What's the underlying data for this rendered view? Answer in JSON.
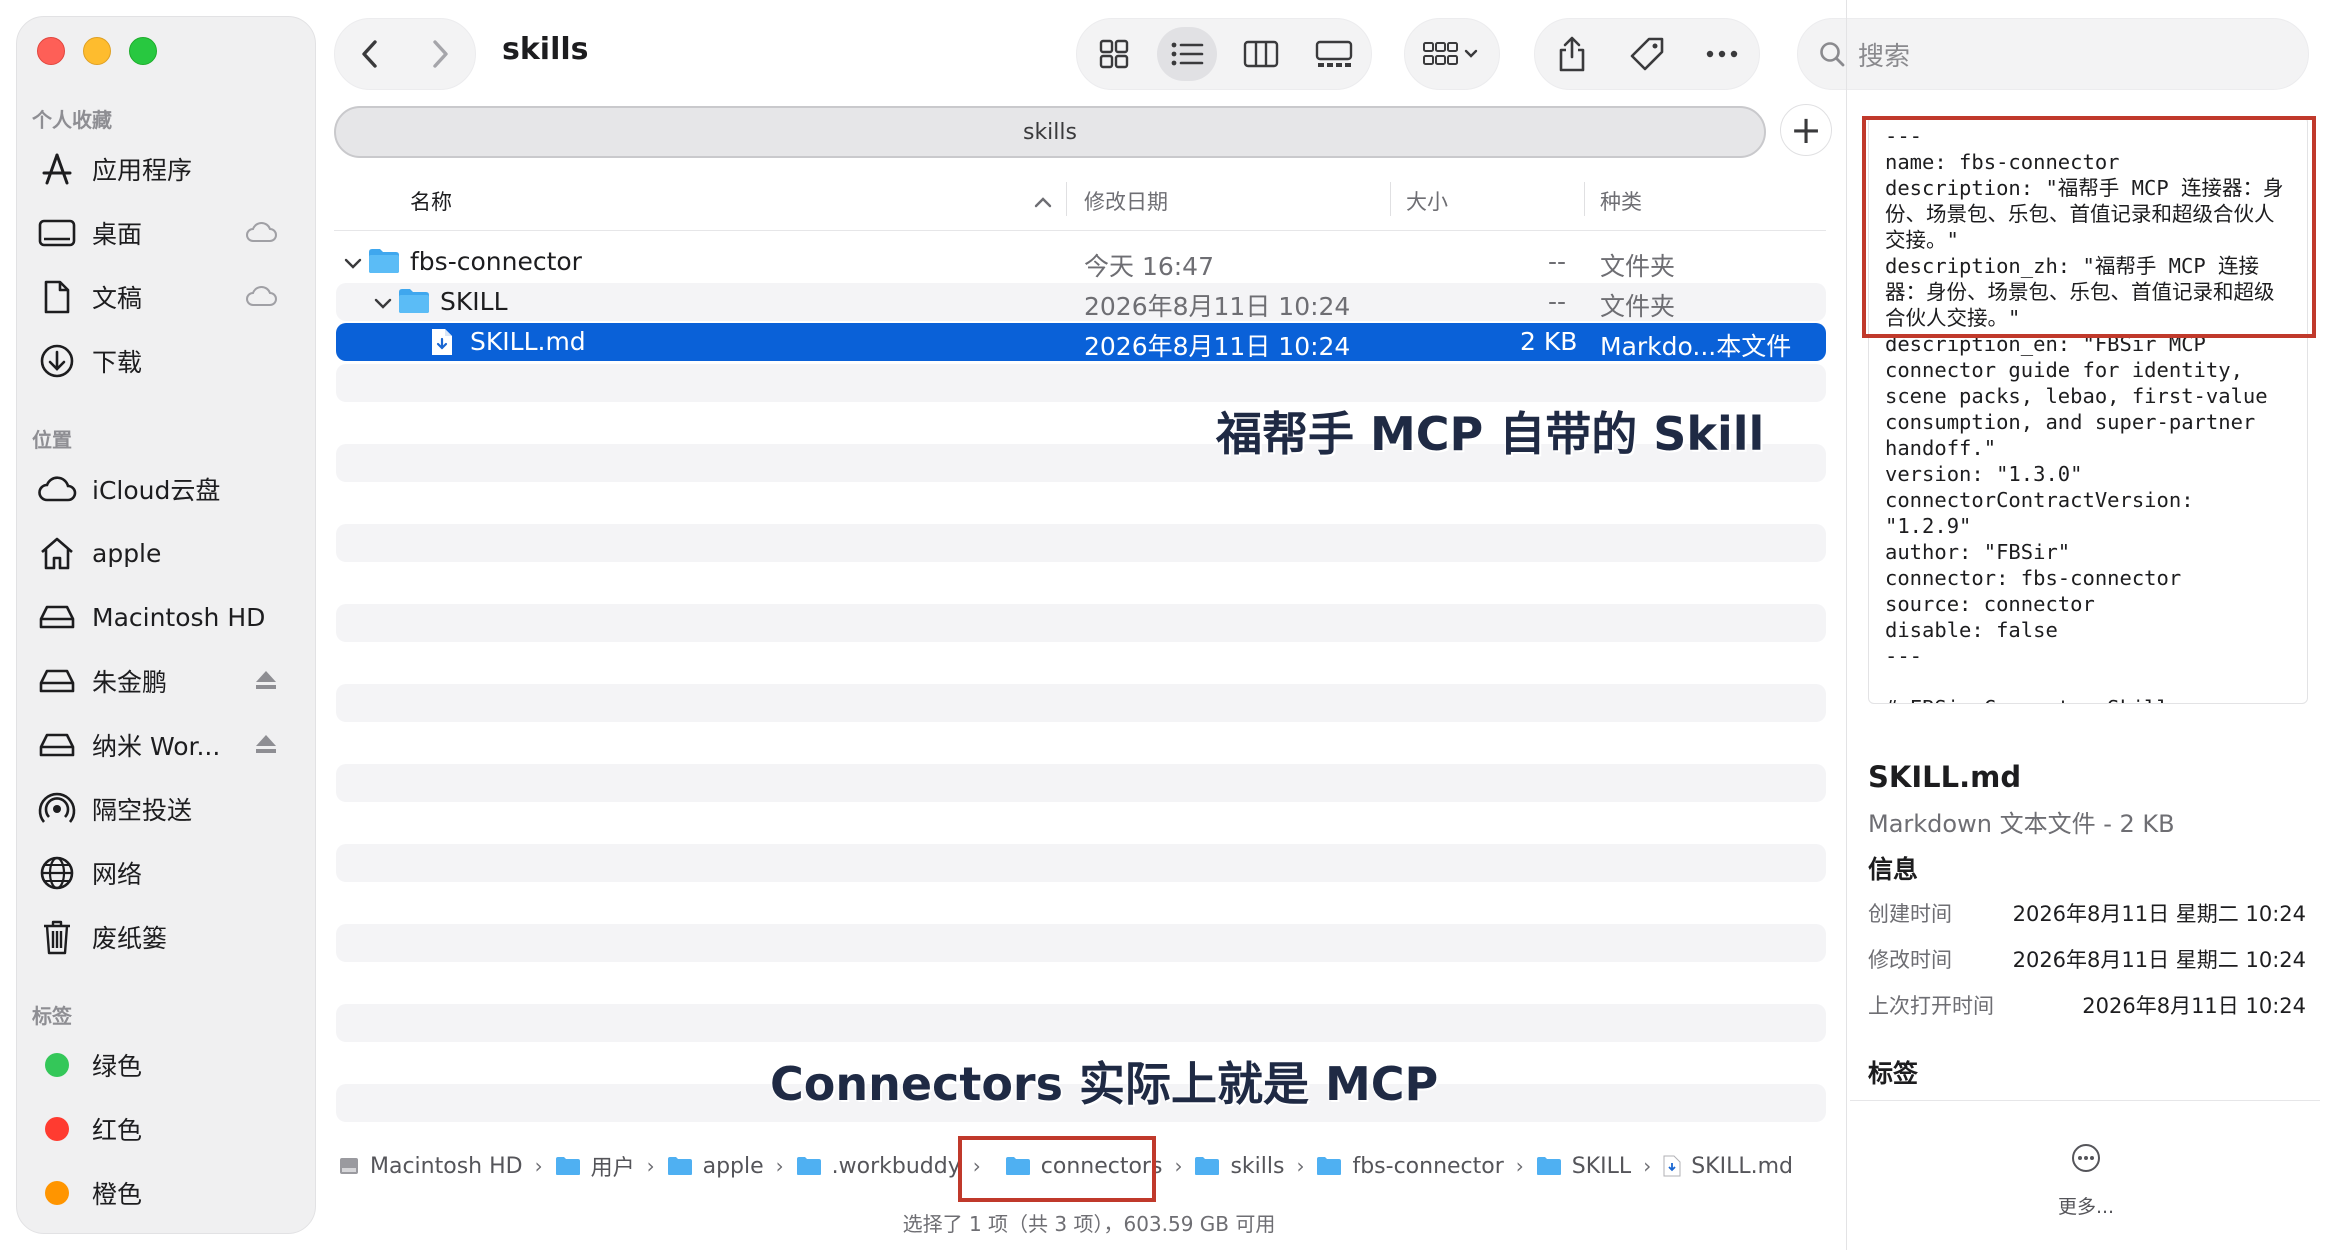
{
  "window": {
    "title": "skills"
  },
  "sidebar": {
    "sections": {
      "favorites": "个人收藏",
      "locations": "位置",
      "tags": "标签"
    },
    "favorites": [
      {
        "label": "应用程序",
        "icon": "applications-icon"
      },
      {
        "label": "桌面",
        "icon": "desktop-icon",
        "trail": "icloud-icon"
      },
      {
        "label": "文稿",
        "icon": "document-icon",
        "trail": "icloud-icon"
      },
      {
        "label": "下载",
        "icon": "download-icon"
      }
    ],
    "locations": [
      {
        "label": "iCloud云盘",
        "icon": "icloud-icon"
      },
      {
        "label": "apple",
        "icon": "home-icon"
      },
      {
        "label": "Macintosh HD",
        "icon": "disk-icon"
      },
      {
        "label": "朱金鹏",
        "icon": "disk-icon",
        "trail": "eject-icon"
      },
      {
        "label": "纳米 Wor...",
        "icon": "disk-icon",
        "trail": "eject-icon"
      },
      {
        "label": "隔空投送",
        "icon": "airdrop-icon"
      },
      {
        "label": "网络",
        "icon": "network-icon"
      },
      {
        "label": "废纸篓",
        "icon": "trash-icon"
      }
    ],
    "tags": [
      {
        "label": "绿色",
        "color": "#34c759"
      },
      {
        "label": "红色",
        "color": "#ff3b30"
      },
      {
        "label": "橙色",
        "color": "#ff9500"
      }
    ]
  },
  "toolbar": {
    "search_placeholder": "搜索"
  },
  "tabbar": {
    "label": "skills"
  },
  "columns": {
    "name": "名称",
    "modified": "修改日期",
    "size": "大小",
    "kind": "种类"
  },
  "files": [
    {
      "name": "fbs-connector",
      "modified": "今天 16:47",
      "size": "--",
      "kind": "文件夹"
    },
    {
      "name": "SKILL",
      "modified": "2026年8月11日 10:24",
      "size": "--",
      "kind": "文件夹"
    },
    {
      "name": "SKILL.md",
      "modified": "2026年8月11日 10:24",
      "size": "2 KB",
      "kind": "Markdo...本文件"
    }
  ],
  "overlays": {
    "top": "福帮手 MCP 自带的 Skill",
    "bottom": "Connectors 实际上就是 MCP"
  },
  "breadcrumb": [
    "Macintosh HD",
    "用户",
    "apple",
    ".workbuddy",
    "connectors",
    "skills",
    "fbs-connector",
    "SKILL",
    "SKILL.md"
  ],
  "status": "选择了 1 项（共 3 项），603.59 GB 可用",
  "preview": {
    "content": "---\nname: fbs-connector\ndescription: \"福帮手 MCP 连接器：身份、场景包、乐包、首值记录和超级合伙人交接。\"\ndescription_zh: \"福帮手 MCP 连接器：身份、场景包、乐包、首值记录和超级合伙人交接。\"\ndescription_en: \"FBSir MCP connector guide for identity, scene packs, lebao, first-value consumption, and super-partner handoff.\"\nversion: \"1.3.0\"\nconnectorContractVersion: \"1.2.9\"\nauthor: \"FBSir\"\nconnector: fbs-connector\nsource: connector\ndisable: false\n---\n\n# FBSir Connector Skill",
    "name": "SKILL.md",
    "kind": "Markdown 文本文件 - 2 KB",
    "info_title": "信息",
    "info": [
      {
        "key": "创建时间",
        "value": "2026年8月11日 星期二 10:24"
      },
      {
        "key": "修改时间",
        "value": "2026年8月11日 星期二 10:24"
      },
      {
        "key": "上次打开时间",
        "value": "2026年8月11日 10:24"
      }
    ],
    "tags_title": "标签",
    "more": "更多..."
  }
}
